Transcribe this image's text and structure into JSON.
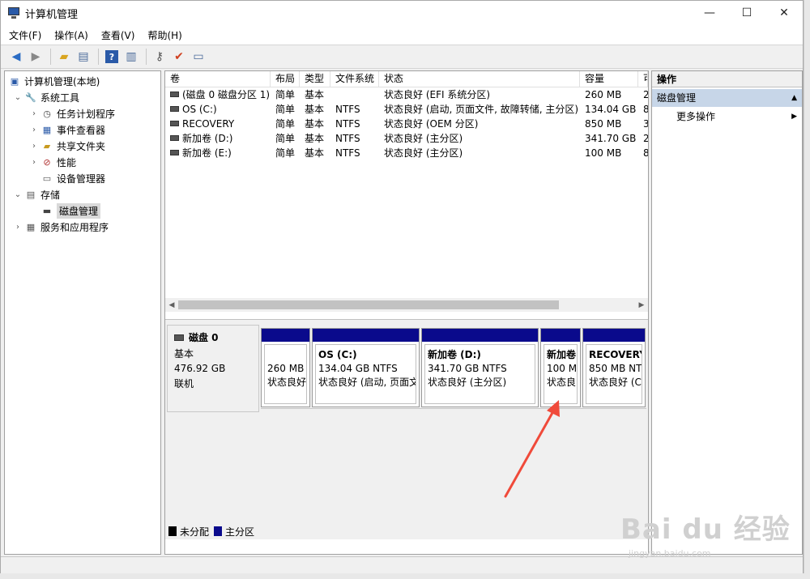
{
  "window": {
    "title": "计算机管理",
    "min": "—",
    "max": "☐",
    "close": "✕"
  },
  "menu": [
    "文件(F)",
    "操作(A)",
    "查看(V)",
    "帮助(H)"
  ],
  "tree": {
    "root": "计算机管理(本地)",
    "system_tools": "系统工具",
    "task_scheduler": "任务计划程序",
    "event_viewer": "事件查看器",
    "shared_folders": "共享文件夹",
    "performance": "性能",
    "device_manager": "设备管理器",
    "storage": "存储",
    "disk_management": "磁盘管理",
    "services": "服务和应用程序"
  },
  "volume_table": {
    "headers": [
      "卷",
      "布局",
      "类型",
      "文件系统",
      "状态",
      "容量",
      "可"
    ],
    "rows": [
      [
        "(磁盘 0 磁盘分区 1)",
        "简单",
        "基本",
        "",
        "状态良好 (EFI 系统分区)",
        "260 MB",
        "2"
      ],
      [
        "OS (C:)",
        "简单",
        "基本",
        "NTFS",
        "状态良好 (启动, 页面文件, 故障转储, 主分区)",
        "134.04 GB",
        "8"
      ],
      [
        "RECOVERY",
        "简单",
        "基本",
        "NTFS",
        "状态良好 (OEM 分区)",
        "850 MB",
        "3"
      ],
      [
        "新加卷 (D:)",
        "简单",
        "基本",
        "NTFS",
        "状态良好 (主分区)",
        "341.70 GB",
        "2"
      ],
      [
        "新加卷 (E:)",
        "简单",
        "基本",
        "NTFS",
        "状态良好 (主分区)",
        "100 MB",
        "8"
      ]
    ]
  },
  "disk": {
    "name": "磁盘 0",
    "type": "基本",
    "size": "476.92 GB",
    "status": "联机",
    "partitions": [
      {
        "name": "",
        "size": "260 MB",
        "status": "状态良好"
      },
      {
        "name": "OS  (C:)",
        "size": "134.04 GB NTFS",
        "status": "状态良好 (启动, 页面文"
      },
      {
        "name": "新加卷  (D:)",
        "size": "341.70 GB NTFS",
        "status": "状态良好 (主分区)"
      },
      {
        "name": "新加卷",
        "size": "100 M",
        "status": "状态良"
      },
      {
        "name": "RECOVERY",
        "size": "850 MB NT",
        "status": "状态良好 (C"
      }
    ]
  },
  "legend": {
    "unallocated": "未分配",
    "primary": "主分区"
  },
  "actions": {
    "header": "操作",
    "section": "磁盘管理",
    "more": "更多操作"
  },
  "watermark": {
    "brand": "Bai du 经验",
    "url": "jingyan.baidu.com"
  },
  "colors": {
    "partition_bar": "#0a0a8c",
    "selected_section": "#c7d6e8",
    "annotation_arrow": "#f04a3a"
  }
}
